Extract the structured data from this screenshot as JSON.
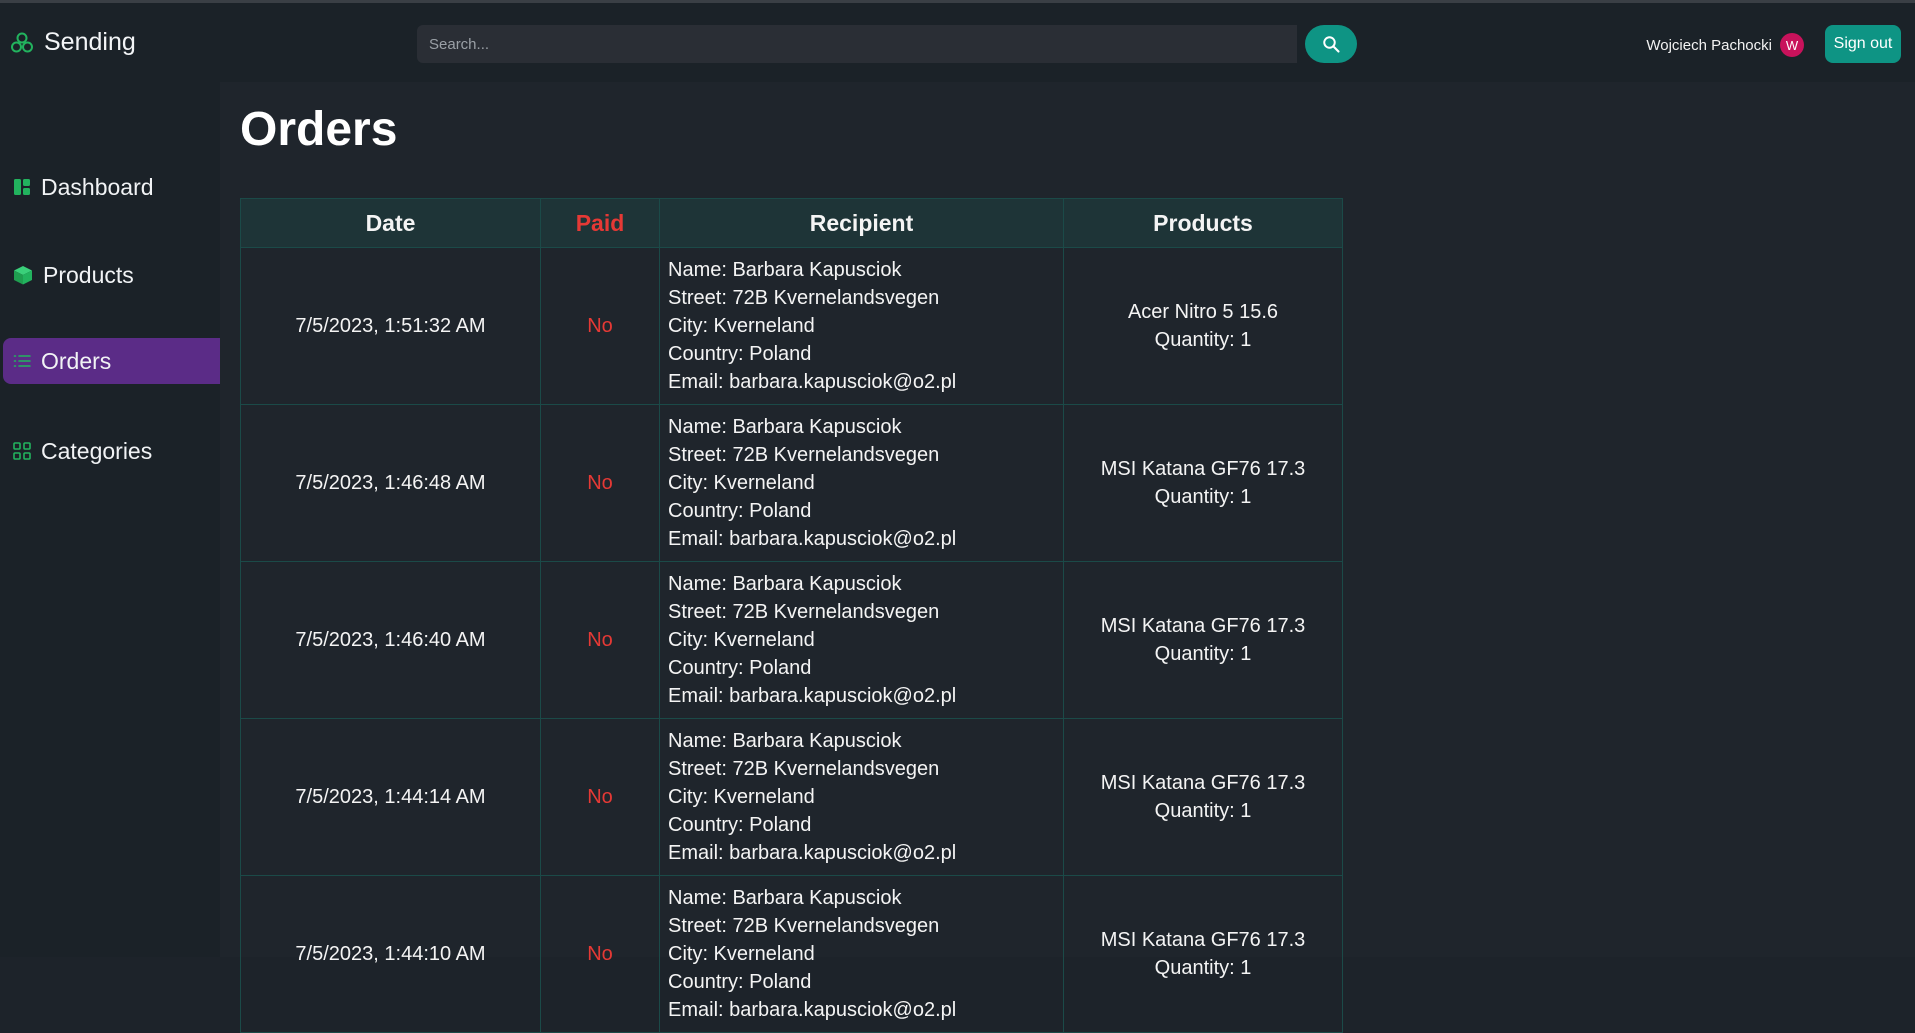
{
  "app": {
    "name": "Sending"
  },
  "search": {
    "placeholder": "Search..."
  },
  "user": {
    "name": "Wojciech Pachocki",
    "initial": "W"
  },
  "header": {
    "sign_out": "Sign out"
  },
  "sidebar": {
    "items": [
      {
        "label": "Dashboard",
        "icon": "dashboard-icon"
      },
      {
        "label": "Products",
        "icon": "cube-icon"
      },
      {
        "label": "Orders",
        "icon": "list-icon",
        "active": true
      },
      {
        "label": "Categories",
        "icon": "grid-icon"
      }
    ]
  },
  "page": {
    "title": "Orders"
  },
  "table": {
    "headers": [
      "Date",
      "Paid",
      "Recipient",
      "Products"
    ],
    "rows": [
      {
        "date": "7/5/2023, 1:51:32 AM",
        "paid": "No",
        "name": "Name: Barbara Kapusciok",
        "street": "Street: 72B Kvernelandsvegen",
        "city": "City: Kverneland",
        "country": "Country: Poland",
        "email": "Email: barbara.kapusciok@o2.pl",
        "product": "Acer Nitro 5 15.6",
        "quantity": "Quantity: 1"
      },
      {
        "date": "7/5/2023, 1:46:48 AM",
        "paid": "No",
        "name": "Name: Barbara Kapusciok",
        "street": "Street: 72B Kvernelandsvegen",
        "city": "City: Kverneland",
        "country": "Country: Poland",
        "email": "Email: barbara.kapusciok@o2.pl",
        "product": "MSI Katana GF76 17.3",
        "quantity": "Quantity: 1"
      },
      {
        "date": "7/5/2023, 1:46:40 AM",
        "paid": "No",
        "name": "Name: Barbara Kapusciok",
        "street": "Street: 72B Kvernelandsvegen",
        "city": "City: Kverneland",
        "country": "Country: Poland",
        "email": "Email: barbara.kapusciok@o2.pl",
        "product": "MSI Katana GF76 17.3",
        "quantity": "Quantity: 1"
      },
      {
        "date": "7/5/2023, 1:44:14 AM",
        "paid": "No",
        "name": "Name: Barbara Kapusciok",
        "street": "Street: 72B Kvernelandsvegen",
        "city": "City: Kverneland",
        "country": "Country: Poland",
        "email": "Email: barbara.kapusciok@o2.pl",
        "product": "MSI Katana GF76 17.3",
        "quantity": "Quantity: 1"
      },
      {
        "date": "7/5/2023, 1:44:10 AM",
        "paid": "No",
        "name": "Name: Barbara Kapusciok",
        "street": "Street: 72B Kvernelandsvegen",
        "city": "City: Kverneland",
        "country": "Country: Poland",
        "email": "Email: barbara.kapusciok@o2.pl",
        "product": "MSI Katana GF76 17.3",
        "quantity": "Quantity: 1"
      }
    ]
  },
  "colors": {
    "accent": "#0e9484",
    "active_nav": "#5b2c87",
    "paid_no": "#e53935",
    "icon_green": "#22b35e",
    "avatar": "#c8125b"
  }
}
